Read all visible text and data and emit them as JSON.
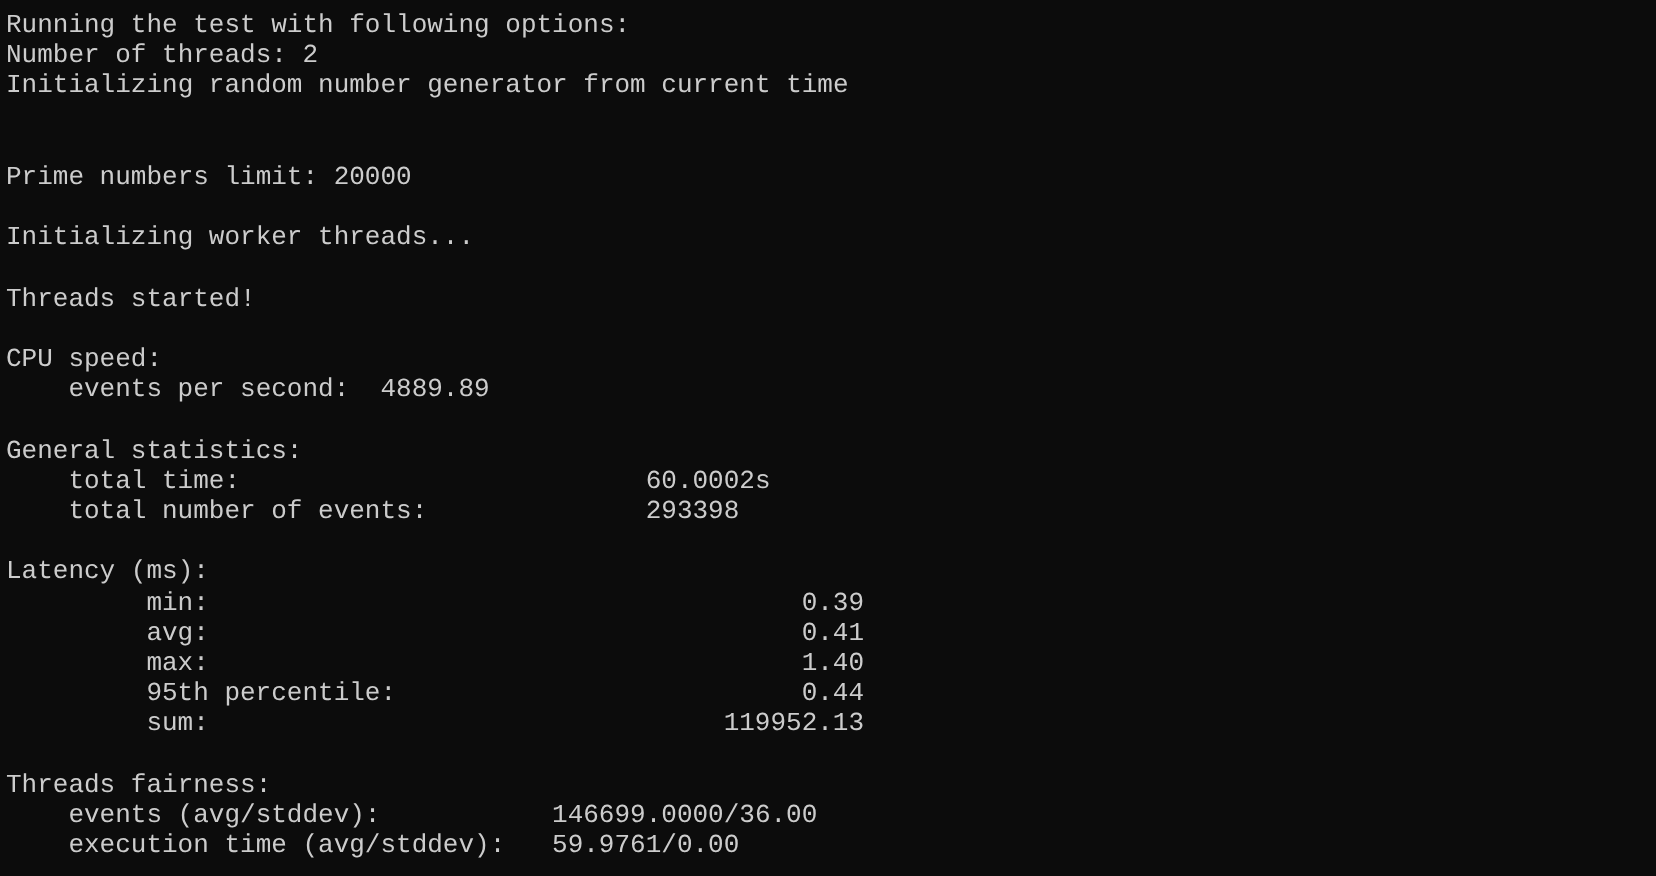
{
  "terminal": {
    "lines": [
      {
        "kind": "text",
        "text": "Running the test with following options:"
      },
      {
        "kind": "text",
        "text": "Number of threads: 2"
      },
      {
        "kind": "text",
        "text": "Initializing random number generator from current time"
      },
      {
        "kind": "blank"
      },
      {
        "kind": "blank"
      },
      {
        "kind": "text",
        "text": "Prime numbers limit: 20000"
      },
      {
        "kind": "blank"
      },
      {
        "kind": "text",
        "text": "Initializing worker threads..."
      },
      {
        "kind": "blank"
      },
      {
        "kind": "text",
        "text": "Threads started!"
      },
      {
        "kind": "blank"
      },
      {
        "kind": "text",
        "text": "CPU speed:"
      },
      {
        "kind": "cpu",
        "label": "events per second:",
        "value": "4889.89"
      },
      {
        "kind": "blank"
      },
      {
        "kind": "text",
        "text": "General statistics:"
      },
      {
        "kind": "stat",
        "label": "total time:",
        "value": "60.0002s"
      },
      {
        "kind": "stat",
        "label": "total number of events:",
        "value": "293398"
      },
      {
        "kind": "blank"
      },
      {
        "kind": "text",
        "text": "Latency (ms):"
      },
      {
        "kind": "latency",
        "label": "min:",
        "value": "0.39"
      },
      {
        "kind": "latency",
        "label": "avg:",
        "value": "0.41"
      },
      {
        "kind": "latency",
        "label": "max:",
        "value": "1.40"
      },
      {
        "kind": "latency",
        "label": "95th percentile:",
        "value": "0.44"
      },
      {
        "kind": "latency",
        "label": "sum:",
        "value": "119952.13"
      },
      {
        "kind": "blank"
      },
      {
        "kind": "text",
        "text": "Threads fairness:"
      },
      {
        "kind": "fairness",
        "label": "events (avg/stddev):",
        "value": "146699.0000/36.00"
      },
      {
        "kind": "fairness",
        "label": "execution time (avg/stddev):",
        "value": "59.9761/0.00"
      }
    ]
  }
}
